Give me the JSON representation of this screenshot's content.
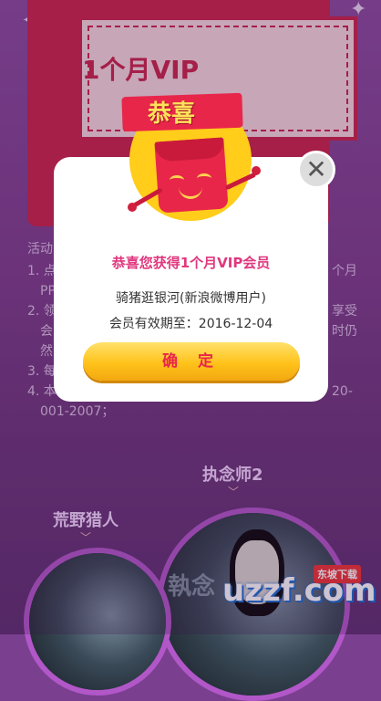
{
  "ticket": {
    "title": "1个月VIP"
  },
  "rules": {
    "heading": "活动",
    "lines": [
      {
        "left": "1. 点",
        "right": "个月"
      },
      {
        "left": "PP",
        "right": ""
      },
      {
        "left": "2. 领",
        "right": "享受"
      },
      {
        "left": "会",
        "right": "时仍"
      },
      {
        "left": "然",
        "right": ""
      },
      {
        "left": "3. 每",
        "right": ""
      },
      {
        "left": "4. 本",
        "right": "20-"
      },
      {
        "left": "001-2007；",
        "right": ""
      }
    ]
  },
  "movies": {
    "left_title": "荒野猎人",
    "right_title": "执念师2",
    "poster_text": "執念"
  },
  "modal": {
    "ribbon_label": "恭喜",
    "title": "恭喜您获得1个月VIP会员",
    "user": "骑猪逛银河(新浪微博用户)",
    "expire": "会员有效期至：2016-12-04",
    "confirm_label": "确 定",
    "close_glyph": "✕"
  },
  "watermark": {
    "logo": "uzzf.com",
    "tag": "东坡下载"
  }
}
